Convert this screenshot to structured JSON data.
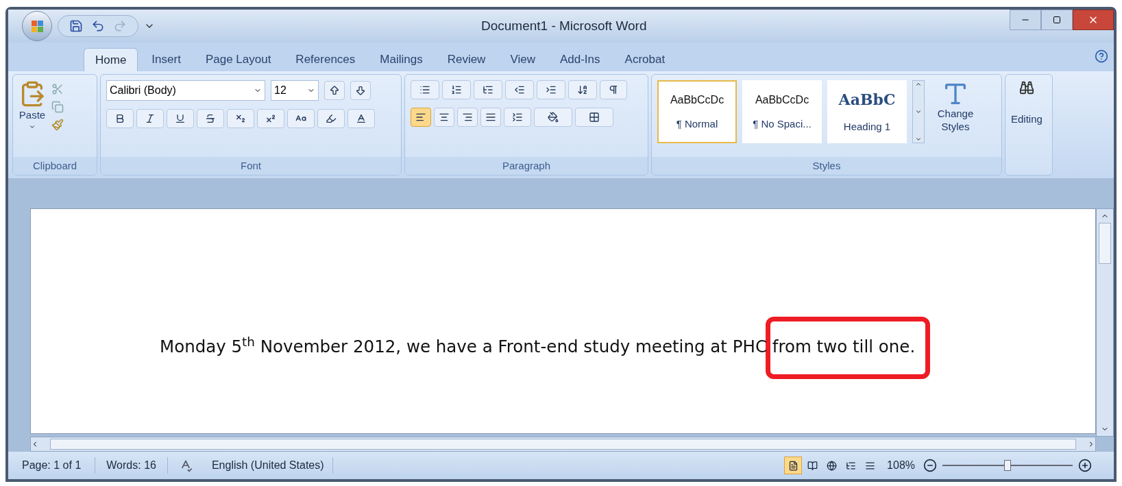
{
  "window": {
    "title": "Document1 - Microsoft Word"
  },
  "tabs": [
    {
      "label": "Home",
      "selected": true
    },
    {
      "label": "Insert",
      "selected": false
    },
    {
      "label": "Page Layout",
      "selected": false
    },
    {
      "label": "References",
      "selected": false
    },
    {
      "label": "Mailings",
      "selected": false
    },
    {
      "label": "Review",
      "selected": false
    },
    {
      "label": "View",
      "selected": false
    },
    {
      "label": "Add-Ins",
      "selected": false
    },
    {
      "label": "Acrobat",
      "selected": false
    }
  ],
  "clipboard": {
    "group": "Clipboard",
    "paste": "Paste"
  },
  "font": {
    "group": "Font",
    "name": "Calibri (Body)",
    "size": "12"
  },
  "paragraph": {
    "group": "Paragraph",
    "align_buttons": [
      {
        "kind": "left",
        "selected": true
      },
      {
        "kind": "center",
        "selected": false
      },
      {
        "kind": "right",
        "selected": false
      },
      {
        "kind": "justify",
        "selected": false
      }
    ],
    "show_marks": {
      "selected": false
    }
  },
  "styles": {
    "group": "Styles",
    "items": [
      {
        "preview": "AaBbCcDc",
        "label": "¶ Normal",
        "kind": "body",
        "selected": true
      },
      {
        "preview": "AaBbCcDc",
        "label": "¶ No Spaci...",
        "kind": "body",
        "selected": false
      },
      {
        "preview": "AaBbC",
        "label": "Heading 1",
        "kind": "heading",
        "selected": false
      }
    ],
    "change": "Change Styles"
  },
  "editing": {
    "label": "Editing"
  },
  "document": {
    "text": "Monday 5$^{th}$ November 2012, we have a Front-end study meeting at PHC from two till one.",
    "highlight": true
  },
  "status_bar": {
    "page": "Page: 1 of 1",
    "words": "Words: 16",
    "language": "English (United States)",
    "views": [
      {
        "selected": true
      },
      {
        "selected": false
      },
      {
        "selected": false
      },
      {
        "selected": false
      },
      {
        "selected": false
      }
    ],
    "zoom": "108%",
    "zoom_level": {
      "level": 0.5
    }
  }
}
